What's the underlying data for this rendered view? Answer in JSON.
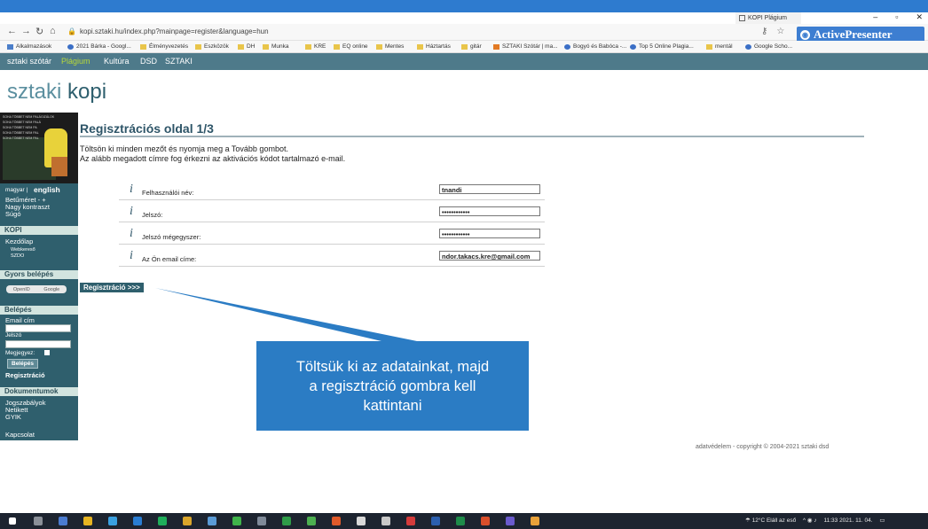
{
  "browser": {
    "tab_title": "KOPI Plágium",
    "url": "kopi.sztaki.hu/index.php?mainpage=register&language=hun",
    "overlay_label": "ActivePresenter",
    "bookmarks": [
      "Alkalmazások",
      "2021 Bárka - Googl...",
      "Élményvezetés",
      "Eszközök",
      "DH",
      "Munka",
      "KRE",
      "EQ online",
      "Mentes",
      "Háztartás",
      "gitár",
      "SZTAKI Szótár | ma...",
      "Bogyó és Babóca -...",
      "Top 5 Online Plagia...",
      "mentál",
      "Google Scho..."
    ]
  },
  "site_nav": {
    "items": [
      "sztaki szótár",
      "Plágium",
      "Kultúra",
      "DSD",
      "SZTAKI"
    ]
  },
  "logo": {
    "part1": "sztaki",
    "part2": "kopi"
  },
  "sidebar": {
    "banner_lines": [
      "SOHA TÖBBET NEM PALÁGIZÁLOK",
      "SOHA TÖBBET NEM PALÁ",
      "SOHA TÖBBET NEM PA",
      "SOHA TÖBBET NEM PAL",
      "SOHA TÖBBET NEM PAL"
    ],
    "lang_magyar": "magyar |",
    "lang_english": "english",
    "font_size": "Betűméret - +",
    "contrast": "Nagy kontraszt",
    "help": "Súgó",
    "kopi_header": "KOPI",
    "kezdolap": "Kezdőlap",
    "webkereso": "Webkereső",
    "szdo": "SZDO",
    "gyors_header": "Gyors belépés",
    "openid_label": "OpenID",
    "google_label": "Google",
    "belepes_header": "Belépés",
    "email_label": "Email cím",
    "jelszo_label": "Jelszó",
    "megjegyez_label": "Megjegyez:",
    "belepes_btn": "Belépés",
    "regisztracio": "Regisztráció",
    "dokumentumok_header": "Dokumentumok",
    "jogszabalyok": "Jogszabályok",
    "netikett": "Netikett",
    "gyik": "GYIK",
    "kapcsolat": "Kapcsolat"
  },
  "main": {
    "title": "Regisztrációs oldal 1/3",
    "intro1": "Töltsön ki minden mezőt és nyomja meg a Tovább gombot.",
    "intro2": "Az alább megadott címre fog érkezni az aktivációs kódot tartalmazó e-mail.",
    "fields": [
      {
        "label": "Felhasználói név:",
        "value": "tnandi"
      },
      {
        "label": "Jelszó:",
        "value": "••••••••••••"
      },
      {
        "label": "Jelszó mégegyszer:",
        "value": "••••••••••••"
      },
      {
        "label": "Az Ön email címe:",
        "value": "ndor.takacs.kre@gmail.com"
      }
    ],
    "register_button": "Regisztráció >>>"
  },
  "callout": {
    "line1": "Töltsük ki az adatainkat, majd",
    "line2": "a regisztráció gombra kell",
    "line3": "kattintani"
  },
  "footer": "adatvédelem - copyright © 2004-2021 sztaki dsd",
  "taskbar": {
    "weather": "12°C Eláll az eső",
    "time": "11:33",
    "date": "2021. 11. 04."
  },
  "colors": {
    "site_nav": "#4e7a8a",
    "sidebar": "#2f5f6d",
    "callout": "#2b7cc4",
    "taskbar": "#1d2430"
  }
}
